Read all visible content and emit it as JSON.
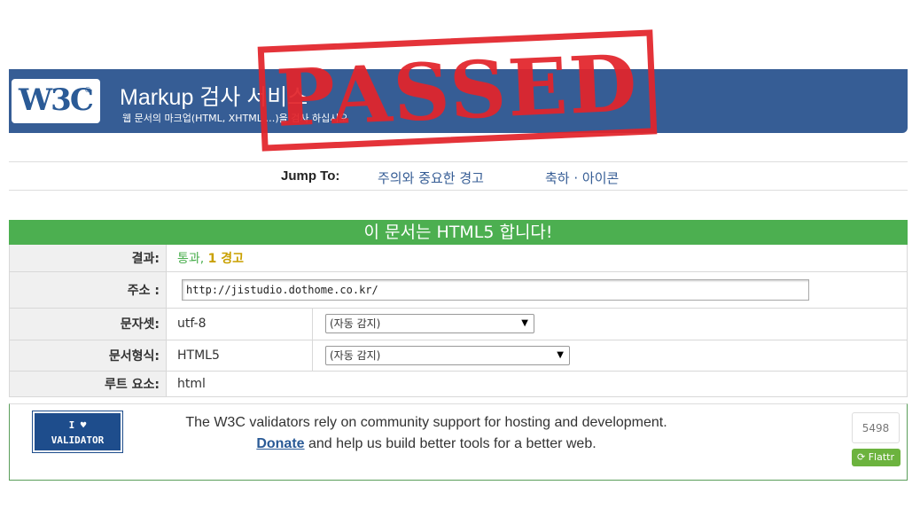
{
  "banner": {
    "logo_text": "W3C",
    "logo_reg": "®",
    "title": "Markup 검사 서비스",
    "subtitle": "웹 문서의 마크업(HTML, XHTML …)을 검사 하십시오"
  },
  "stamp": {
    "text": "PASSED"
  },
  "jump": {
    "label": "Jump To:",
    "links": [
      "주의와 중요한 경고",
      "축하 · 아이콘"
    ]
  },
  "result": {
    "header": "이 문서는 HTML5 합니다!",
    "rows": {
      "result_label": "결과:",
      "result_pass": "통과,",
      "result_warn": "1 경고",
      "address_label": "주소 :",
      "address_value": "http://jistudio.dothome.co.kr/",
      "charset_label": "문자셋:",
      "charset_value": "utf-8",
      "charset_select": "(자동 감지)",
      "doctype_label": "문서형식:",
      "doctype_value": "HTML5",
      "doctype_select": "(자동 감지)",
      "root_label": "루트 요소:",
      "root_value": "html"
    }
  },
  "donation": {
    "badge_line1": "I ♥",
    "badge_line2": "VALIDATOR",
    "text1": "The W3C validators rely on community support for hosting and development.",
    "donate_link": "Donate",
    "text2": " and help us build better tools for a better web.",
    "flattr_count": "5498",
    "flattr_label": "Flattr"
  },
  "colors": {
    "banner": "#365d95",
    "success": "#4caf50",
    "warning": "#c9a000",
    "stamp": "#e3242b"
  }
}
